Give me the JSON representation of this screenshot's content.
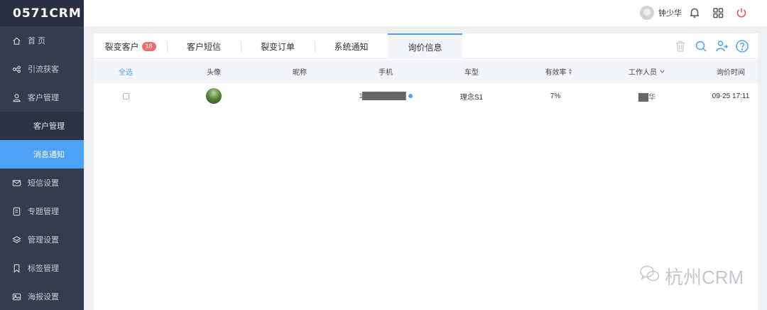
{
  "app": {
    "logo": "0571CRM"
  },
  "sidebar": {
    "items": [
      {
        "label": "首 页",
        "icon": "home-icon"
      },
      {
        "label": "引流获客",
        "icon": "share-icon"
      },
      {
        "label": "客户管理",
        "icon": "user-icon"
      },
      {
        "label": "客户管理",
        "sub": true
      },
      {
        "label": "消息通知",
        "sub": true,
        "active": true
      },
      {
        "label": "短信设置",
        "icon": "mail-icon"
      },
      {
        "label": "专题管理",
        "icon": "topic-icon"
      },
      {
        "label": "管理设置",
        "icon": "layers-icon"
      },
      {
        "label": "标签管理",
        "icon": "bookmark-icon"
      },
      {
        "label": "海报设置",
        "icon": "image-icon"
      }
    ]
  },
  "topbar": {
    "user_name": "钟少华"
  },
  "tabs": [
    {
      "label": "裂变客户",
      "badge": "18"
    },
    {
      "label": "客户短信"
    },
    {
      "label": "裂变订单"
    },
    {
      "label": "系统通知"
    },
    {
      "label": "询价信息",
      "active": true
    }
  ],
  "table": {
    "headers": [
      "全选",
      "头像",
      "昵称",
      "手机",
      "车型",
      "有效率",
      "工作人员",
      "询价时间"
    ],
    "rows": [
      {
        "nickname": "",
        "phone": "1██████████",
        "model": "理念S1",
        "rate": "7%",
        "staff": "██华",
        "time": "09-25 17:11"
      }
    ]
  },
  "watermark": "杭州CRM",
  "colors": {
    "accent": "#4da2f7",
    "sidebar": "#353c4e",
    "badge": "#f26b6b",
    "logout": "#e94e4e"
  }
}
